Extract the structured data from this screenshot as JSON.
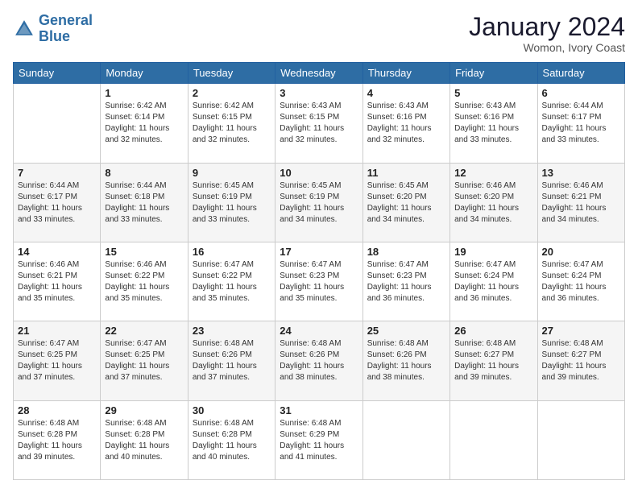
{
  "logo": {
    "line1": "General",
    "line2": "Blue"
  },
  "title": "January 2024",
  "subtitle": "Womon, Ivory Coast",
  "weekdays": [
    "Sunday",
    "Monday",
    "Tuesday",
    "Wednesday",
    "Thursday",
    "Friday",
    "Saturday"
  ],
  "weeks": [
    [
      {
        "day": "",
        "info": ""
      },
      {
        "day": "1",
        "info": "Sunrise: 6:42 AM\nSunset: 6:14 PM\nDaylight: 11 hours\nand 32 minutes."
      },
      {
        "day": "2",
        "info": "Sunrise: 6:42 AM\nSunset: 6:15 PM\nDaylight: 11 hours\nand 32 minutes."
      },
      {
        "day": "3",
        "info": "Sunrise: 6:43 AM\nSunset: 6:15 PM\nDaylight: 11 hours\nand 32 minutes."
      },
      {
        "day": "4",
        "info": "Sunrise: 6:43 AM\nSunset: 6:16 PM\nDaylight: 11 hours\nand 32 minutes."
      },
      {
        "day": "5",
        "info": "Sunrise: 6:43 AM\nSunset: 6:16 PM\nDaylight: 11 hours\nand 33 minutes."
      },
      {
        "day": "6",
        "info": "Sunrise: 6:44 AM\nSunset: 6:17 PM\nDaylight: 11 hours\nand 33 minutes."
      }
    ],
    [
      {
        "day": "7",
        "info": "Sunrise: 6:44 AM\nSunset: 6:17 PM\nDaylight: 11 hours\nand 33 minutes."
      },
      {
        "day": "8",
        "info": "Sunrise: 6:44 AM\nSunset: 6:18 PM\nDaylight: 11 hours\nand 33 minutes."
      },
      {
        "day": "9",
        "info": "Sunrise: 6:45 AM\nSunset: 6:19 PM\nDaylight: 11 hours\nand 33 minutes."
      },
      {
        "day": "10",
        "info": "Sunrise: 6:45 AM\nSunset: 6:19 PM\nDaylight: 11 hours\nand 34 minutes."
      },
      {
        "day": "11",
        "info": "Sunrise: 6:45 AM\nSunset: 6:20 PM\nDaylight: 11 hours\nand 34 minutes."
      },
      {
        "day": "12",
        "info": "Sunrise: 6:46 AM\nSunset: 6:20 PM\nDaylight: 11 hours\nand 34 minutes."
      },
      {
        "day": "13",
        "info": "Sunrise: 6:46 AM\nSunset: 6:21 PM\nDaylight: 11 hours\nand 34 minutes."
      }
    ],
    [
      {
        "day": "14",
        "info": "Sunrise: 6:46 AM\nSunset: 6:21 PM\nDaylight: 11 hours\nand 35 minutes."
      },
      {
        "day": "15",
        "info": "Sunrise: 6:46 AM\nSunset: 6:22 PM\nDaylight: 11 hours\nand 35 minutes."
      },
      {
        "day": "16",
        "info": "Sunrise: 6:47 AM\nSunset: 6:22 PM\nDaylight: 11 hours\nand 35 minutes."
      },
      {
        "day": "17",
        "info": "Sunrise: 6:47 AM\nSunset: 6:23 PM\nDaylight: 11 hours\nand 35 minutes."
      },
      {
        "day": "18",
        "info": "Sunrise: 6:47 AM\nSunset: 6:23 PM\nDaylight: 11 hours\nand 36 minutes."
      },
      {
        "day": "19",
        "info": "Sunrise: 6:47 AM\nSunset: 6:24 PM\nDaylight: 11 hours\nand 36 minutes."
      },
      {
        "day": "20",
        "info": "Sunrise: 6:47 AM\nSunset: 6:24 PM\nDaylight: 11 hours\nand 36 minutes."
      }
    ],
    [
      {
        "day": "21",
        "info": "Sunrise: 6:47 AM\nSunset: 6:25 PM\nDaylight: 11 hours\nand 37 minutes."
      },
      {
        "day": "22",
        "info": "Sunrise: 6:47 AM\nSunset: 6:25 PM\nDaylight: 11 hours\nand 37 minutes."
      },
      {
        "day": "23",
        "info": "Sunrise: 6:48 AM\nSunset: 6:26 PM\nDaylight: 11 hours\nand 37 minutes."
      },
      {
        "day": "24",
        "info": "Sunrise: 6:48 AM\nSunset: 6:26 PM\nDaylight: 11 hours\nand 38 minutes."
      },
      {
        "day": "25",
        "info": "Sunrise: 6:48 AM\nSunset: 6:26 PM\nDaylight: 11 hours\nand 38 minutes."
      },
      {
        "day": "26",
        "info": "Sunrise: 6:48 AM\nSunset: 6:27 PM\nDaylight: 11 hours\nand 39 minutes."
      },
      {
        "day": "27",
        "info": "Sunrise: 6:48 AM\nSunset: 6:27 PM\nDaylight: 11 hours\nand 39 minutes."
      }
    ],
    [
      {
        "day": "28",
        "info": "Sunrise: 6:48 AM\nSunset: 6:28 PM\nDaylight: 11 hours\nand 39 minutes."
      },
      {
        "day": "29",
        "info": "Sunrise: 6:48 AM\nSunset: 6:28 PM\nDaylight: 11 hours\nand 40 minutes."
      },
      {
        "day": "30",
        "info": "Sunrise: 6:48 AM\nSunset: 6:28 PM\nDaylight: 11 hours\nand 40 minutes."
      },
      {
        "day": "31",
        "info": "Sunrise: 6:48 AM\nSunset: 6:29 PM\nDaylight: 11 hours\nand 41 minutes."
      },
      {
        "day": "",
        "info": ""
      },
      {
        "day": "",
        "info": ""
      },
      {
        "day": "",
        "info": ""
      }
    ]
  ]
}
